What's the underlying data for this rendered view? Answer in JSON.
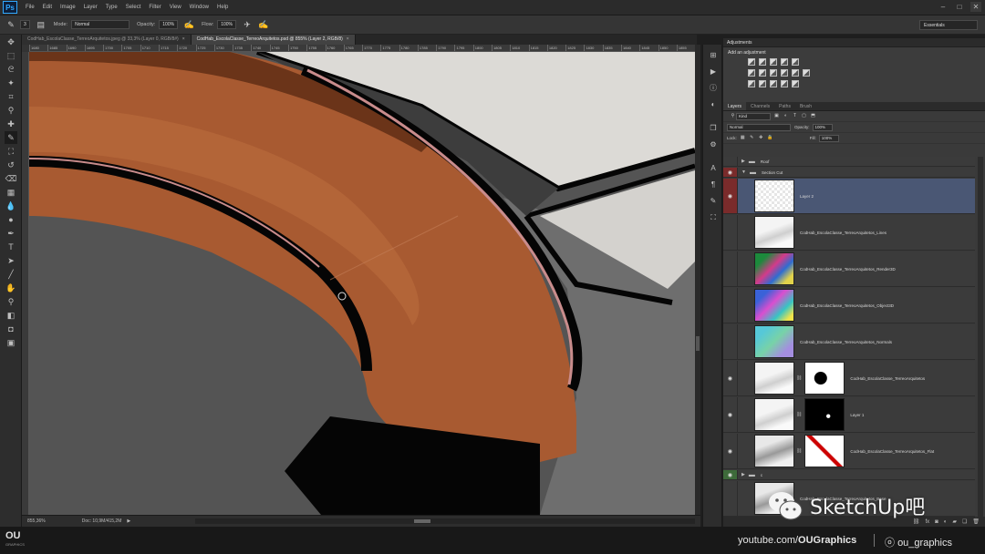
{
  "app": {
    "logo": "Ps"
  },
  "menu": [
    "File",
    "Edit",
    "Image",
    "Layer",
    "Type",
    "Select",
    "Filter",
    "View",
    "Window",
    "Help"
  ],
  "options": {
    "mode_label": "Mode:",
    "mode_value": "Normal",
    "opacity_label": "Opacity:",
    "opacity_value": "100%",
    "flow_label": "Flow:",
    "flow_value": "100%",
    "brush_size": "3",
    "workspace": "Essentials"
  },
  "tabs": [
    {
      "label": "CodHab_EscolaClasse_TerreoArquitetos.jpeg @ 33,3% (Layer 0, RGB/8#)",
      "active": false
    },
    {
      "label": "CodHab_EscolaClasse_TerreoArquitetos.psd @ 855% (Layer 2, RGB/8)",
      "active": true
    }
  ],
  "ruler": [
    "1680",
    "1685",
    "1690",
    "1695",
    "1700",
    "1705",
    "1710",
    "1715",
    "1720",
    "1725",
    "1730",
    "1735",
    "1740",
    "1745",
    "1750",
    "1755",
    "1760",
    "1765",
    "1770",
    "1775",
    "1780",
    "1785",
    "1790",
    "1795",
    "1800",
    "1805",
    "1810",
    "1815",
    "1820",
    "1825",
    "1830",
    "1835",
    "1840",
    "1845",
    "1850",
    "1855"
  ],
  "status": {
    "zoom": "855,36%",
    "doc": "Doc: 10,9M/415,2M"
  },
  "adjustments": {
    "title": "Adjustments",
    "subtitle": "Add an adjustment"
  },
  "layers_panel": {
    "tabs": [
      "Layers",
      "Channels",
      "Paths",
      "Brush"
    ],
    "kind": "Kind",
    "blend": "Normal",
    "opacity_label": "Opacity:",
    "opacity_value": "100%",
    "lock_label": "Lock:",
    "fill_label": "Fill:",
    "fill_value": "100%"
  },
  "layers": [
    {
      "name": "Roof",
      "type": "group",
      "eye": "",
      "selected": false
    },
    {
      "name": "Section Cut",
      "type": "group-open",
      "eye": "red",
      "selected": false
    },
    {
      "name": "Layer 2",
      "type": "layer",
      "eye": "red",
      "selected": true,
      "thumb": "transparent"
    },
    {
      "name": "CodHab_EscolaClasse_TerreoArquitetos_Lines",
      "type": "layer",
      "eye": "",
      "selected": false,
      "thumb": "lines"
    },
    {
      "name": "CodHab_EscolaClasse_TerreoArquitetos_Render3D",
      "type": "layer",
      "eye": "",
      "selected": false,
      "thumb": "render"
    },
    {
      "name": "CodHab_EscolaClasse_TerreoArquitetos_Object3D",
      "type": "layer",
      "eye": "",
      "selected": false,
      "thumb": "object"
    },
    {
      "name": "CodHab_EscolaClasse_TerreoArquitetos_Normals",
      "type": "layer",
      "eye": "",
      "selected": false,
      "thumb": "normals"
    },
    {
      "name": "CodHab_EscolaClasse_TerreoArquitetos",
      "type": "masked",
      "eye": "on",
      "selected": false,
      "thumb": "lines",
      "mask": "mask1"
    },
    {
      "name": "Layer 1",
      "type": "masked",
      "eye": "on",
      "selected": false,
      "thumb": "lines",
      "mask": "mask2"
    },
    {
      "name": "CodHab_EscolaClasse_TerreoArquitetos_Flat",
      "type": "masked",
      "eye": "on",
      "selected": false,
      "thumb": "flat",
      "mask": "mask3"
    },
    {
      "name": "c",
      "type": "group",
      "eye": "green",
      "selected": false
    },
    {
      "name": "CodHab_EscolaClasse_TerreoArquitetos_Base",
      "type": "layer",
      "eye": "",
      "selected": false,
      "thumb": "flat"
    }
  ],
  "bottom": {
    "logo": "OU",
    "logo_sub": "GRAPHICS",
    "youtube_prefix": "youtube.com/",
    "youtube_bold": "OUGraphics",
    "instagram": "ou_graphics"
  },
  "watermark": "SketchUp吧",
  "colors": {
    "surface": "#a85a31",
    "edge_highlight": "#c98c8c",
    "wall": "#dcdad6",
    "ground": "#545454",
    "selection": "#4a5774"
  }
}
